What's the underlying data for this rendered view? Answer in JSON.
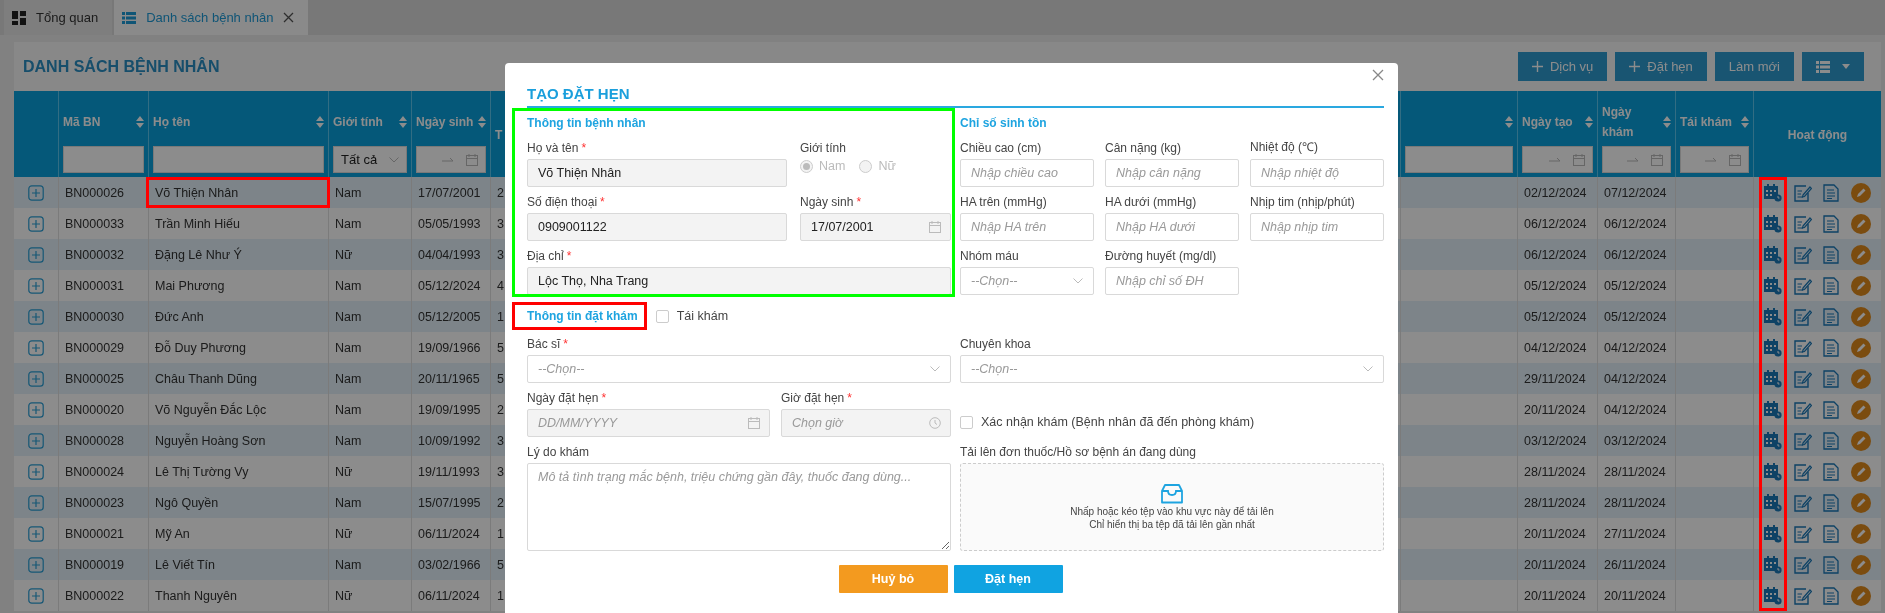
{
  "tabs": [
    {
      "label": "Tổng quan",
      "kind": "dashboard",
      "selected": false,
      "closable": false
    },
    {
      "label": "Danh sách bệnh nhân",
      "kind": "list",
      "selected": true,
      "closable": true
    }
  ],
  "page": {
    "title": "DANH SÁCH BỆNH NHÂN",
    "toolbar": [
      {
        "kind": "add",
        "label": "Dịch vụ"
      },
      {
        "kind": "add",
        "label": "Đặt hẹn"
      },
      {
        "kind": "plain",
        "label": "Làm mới"
      },
      {
        "kind": "columns_menu"
      }
    ]
  },
  "table": {
    "schedule_highlight": {
      "color": "#ff0000"
    },
    "columns": [
      {
        "kind": "expand"
      },
      {
        "kind": "data",
        "label": "Mã BN",
        "sortable": true,
        "filter": {
          "kind": "text"
        }
      },
      {
        "kind": "data",
        "label": "Họ tên",
        "sortable": true,
        "filter": {
          "kind": "text"
        }
      },
      {
        "kind": "data",
        "label": "Giới tính",
        "sortable": true,
        "filter": {
          "kind": "select",
          "value": "Tất cả"
        }
      },
      {
        "kind": "data",
        "label": "Ngày sinh",
        "sortable": true,
        "filter": {
          "kind": "date_range"
        }
      },
      {
        "kind": "data",
        "label": "T",
        "sortable": false
      },
      {
        "kind": "data",
        "sortable": true,
        "filter": {
          "kind": "text"
        }
      },
      {
        "kind": "data",
        "label": "Ngày tạo",
        "sortable": true,
        "filter": {
          "kind": "date_range"
        }
      },
      {
        "kind": "data",
        "label": "Ngày khám",
        "sortable": true,
        "filter": {
          "kind": "date_range"
        }
      },
      {
        "kind": "data",
        "label": "Tái khám",
        "sortable": true,
        "filter": {
          "kind": "date_range"
        }
      },
      {
        "kind": "actions",
        "label": "Hoạt động"
      }
    ],
    "rows": [
      {
        "cells": [
          "",
          "BN000026",
          "Võ Thiện Nhân",
          "Nam",
          "17/07/2001",
          "2",
          "",
          "02/12/2024",
          "07/12/2024",
          "",
          ""
        ],
        "highlight": {
          "color": "#ff0000"
        }
      },
      {
        "cells": [
          "",
          "BN000033",
          "Trần Minh Hiếu",
          "Nam",
          "05/05/1993",
          "3",
          "",
          "06/12/2024",
          "06/12/2024",
          "",
          ""
        ]
      },
      {
        "cells": [
          "",
          "BN000032",
          "Đặng Lê Như Ý",
          "Nữ",
          "04/04/1993",
          "3",
          "",
          "06/12/2024",
          "06/12/2024",
          "",
          ""
        ]
      },
      {
        "cells": [
          "",
          "BN000031",
          "Mai Phương",
          "Nam",
          "05/12/2024",
          "4",
          "",
          "05/12/2024",
          "05/12/2024",
          "",
          ""
        ]
      },
      {
        "cells": [
          "",
          "BN000030",
          "Đức Anh",
          "Nam",
          "05/12/2005",
          "1",
          "",
          "05/12/2024",
          "05/12/2024",
          "",
          ""
        ]
      },
      {
        "cells": [
          "",
          "BN000029",
          "Đỗ Duy Phương",
          "Nam",
          "19/09/1966",
          "5",
          "",
          "04/12/2024",
          "04/12/2024",
          "",
          ""
        ]
      },
      {
        "cells": [
          "",
          "BN000025",
          "Châu Thanh Dũng",
          "Nam",
          "20/11/1965",
          "5",
          "",
          "29/11/2024",
          "04/12/2024",
          "",
          ""
        ]
      },
      {
        "cells": [
          "",
          "BN000020",
          "Võ Nguyễn Đắc Lộc",
          "Nam",
          "19/09/1995",
          "2",
          "",
          "20/11/2024",
          "04/12/2024",
          "",
          ""
        ]
      },
      {
        "cells": [
          "",
          "BN000028",
          "Nguyễn Hoàng Sơn",
          "Nam",
          "10/09/1992",
          "3",
          "",
          "03/12/2024",
          "03/12/2024",
          "",
          ""
        ]
      },
      {
        "cells": [
          "",
          "BN000024",
          "Lê Thị Tường Vy",
          "Nữ",
          "19/11/1993",
          "3",
          "",
          "28/11/2024",
          "28/11/2024",
          "",
          ""
        ]
      },
      {
        "cells": [
          "",
          "BN000023",
          "Ngô Quyền",
          "Nam",
          "15/07/1995",
          "2",
          "",
          "28/11/2024",
          "28/11/2024",
          "",
          ""
        ]
      },
      {
        "cells": [
          "",
          "BN000021",
          "Mỹ An",
          "Nữ",
          "06/11/2024",
          "1",
          "",
          "20/11/2024",
          "27/11/2024",
          "",
          ""
        ]
      },
      {
        "cells": [
          "",
          "BN000019",
          "Lê Viết Tín",
          "Nam",
          "03/02/1966",
          "5",
          "",
          "20/11/2024",
          "26/11/2024",
          "",
          ""
        ]
      },
      {
        "cells": [
          "",
          "BN000022",
          "Thanh Nguyên",
          "Nữ",
          "06/11/2024",
          "1",
          "",
          "20/11/2024",
          "20/11/2024",
          "",
          ""
        ]
      }
    ]
  },
  "modal": {
    "title": "TẠO ĐẶT HẸN",
    "patient_section": {
      "heading": "Thông tin bệnh nhân",
      "highlight": {
        "color": "#00ff00"
      },
      "fields": [
        {
          "kind": "text",
          "label": "Họ và tên",
          "required": "*",
          "value": "Võ Thiện Nhân",
          "disabled": true
        },
        {
          "kind": "radio",
          "label": "Giới tính",
          "disabled": true,
          "options": [
            {
              "label": "Nam",
              "selected": true
            },
            {
              "label": "Nữ",
              "selected": false
            }
          ]
        },
        {
          "kind": "text",
          "label": "Số điện thoại",
          "required": "*",
          "value": "0909001122",
          "disabled": true
        },
        {
          "kind": "date",
          "label": "Ngày sinh",
          "required": "*",
          "value": "17/07/2001",
          "disabled": true
        },
        {
          "kind": "text",
          "label": "Địa chỉ",
          "required": "*",
          "value": "Lộc Thọ, Nha Trang",
          "disabled": true
        }
      ]
    },
    "vitals_section": {
      "heading": "Chỉ số sinh tồn",
      "fields": [
        {
          "kind": "text",
          "label": "Chiều cao (cm)",
          "placeholder": "Nhập chiều cao",
          "disabled": false
        },
        {
          "kind": "text",
          "label": "Cân nặng (kg)",
          "placeholder": "Nhập cân nặng",
          "disabled": false
        },
        {
          "kind": "text",
          "label": "Nhiệt độ (℃)",
          "placeholder": "Nhập nhiệt độ",
          "disabled": false
        },
        {
          "kind": "text",
          "label": "HA trên (mmHg)",
          "placeholder": "Nhập HA trên",
          "disabled": false
        },
        {
          "kind": "text",
          "label": "HA dưới (mmHg)",
          "placeholder": "Nhập HA dưới",
          "disabled": false
        },
        {
          "kind": "text",
          "label": "Nhịp tim (nhịp/phút)",
          "placeholder": "Nhập nhịp tim",
          "disabled": false
        },
        {
          "kind": "select",
          "label": "Nhóm máu",
          "placeholder": "--Chọn--",
          "disabled": false
        },
        {
          "kind": "text",
          "label": "Đường huyết (mg/dl)",
          "placeholder": "Nhập chỉ số ĐH",
          "disabled": false
        }
      ]
    },
    "booking_section": {
      "heading": "Thông tin đặt khám",
      "highlight": {
        "color": "#ff0000"
      },
      "recheck": {
        "label": "Tái khám",
        "checked": false
      },
      "fields": [
        {
          "kind": "select",
          "label": "Bác sĩ",
          "required": "*",
          "placeholder": "--Chọn--",
          "disabled": false
        },
        {
          "kind": "select",
          "label": "Chuyên khoa",
          "placeholder": "--Chọn--",
          "disabled": false
        },
        {
          "kind": "date",
          "label": "Ngày đặt hẹn",
          "required": "*",
          "placeholder": "DD/MM/YYYY",
          "disabled": true
        },
        {
          "kind": "time",
          "label": "Giờ đặt hẹn",
          "required": "*",
          "placeholder": "Chọn giờ",
          "disabled": true
        },
        {
          "kind": "checkbox",
          "label": "Xác nhận khám (Bệnh nhân đã đến phòng khám)",
          "checked": false
        },
        {
          "kind": "textarea",
          "label": "Lý do khám",
          "placeholder": "Mô tả tình trạng mắc bệnh, triệu chứng gần đây, thuốc đang dùng..."
        },
        {
          "kind": "upload",
          "label": "Tải lên đơn thuốc/Hồ sơ bệnh án đang dùng",
          "hint": "Nhấp hoặc kéo tệp vào khu vực này để tải lên",
          "note": "Chỉ hiển thị ba tệp đã tải lên gần nhất"
        }
      ]
    },
    "buttons": [
      {
        "kind": "cancel",
        "label": "Huỷ bỏ"
      },
      {
        "kind": "submit",
        "label": "Đặt hẹn"
      }
    ]
  }
}
